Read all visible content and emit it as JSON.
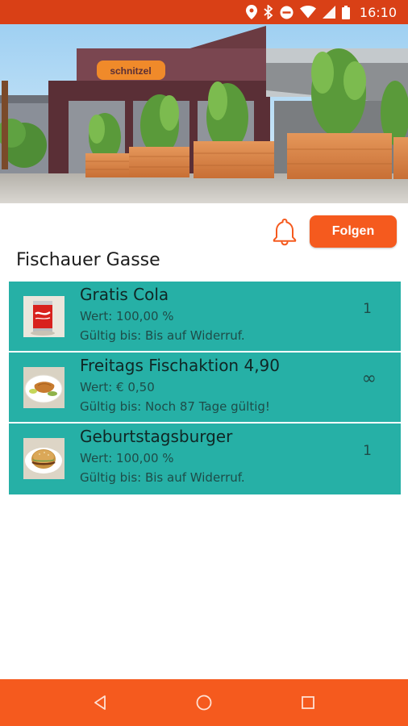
{
  "status_bar": {
    "time": "16:10",
    "icons": [
      "location-icon",
      "bluetooth-icon",
      "do-not-disturb-icon",
      "wifi-icon",
      "signal-icon",
      "battery-icon"
    ]
  },
  "hero": {
    "image": "restaurant-storefront-photo",
    "sign_text": "schnitzel"
  },
  "actions": {
    "notification_icon": "bell-icon",
    "follow_label": "Folgen",
    "accent_color": "#f55a1e"
  },
  "location": {
    "title": "Fischauer Gasse"
  },
  "offers": [
    {
      "title": "Gratis Cola",
      "value": "Wert: 100,00 %",
      "valid": "Gültig bis: Bis auf Widerruf.",
      "count": "1",
      "thumb": "cola-can-image"
    },
    {
      "title": "Freitags Fischaktion 4,90",
      "value": "Wert: € 0,50",
      "valid": "Gültig bis: Noch 87 Tage gültig!",
      "count": "∞",
      "thumb": "fish-plate-image"
    },
    {
      "title": "Geburtstagsburger",
      "value": "Wert: 100,00 %",
      "valid": "Gültig bis: Bis auf Widerruf.",
      "count": "1",
      "thumb": "burger-plate-image"
    }
  ],
  "colors": {
    "status_bar": "#d94016",
    "offer_background": "#26b0a6",
    "nav_bar": "#f55a1e"
  },
  "nav": {
    "buttons": [
      "back-icon",
      "home-icon",
      "recents-icon"
    ]
  }
}
